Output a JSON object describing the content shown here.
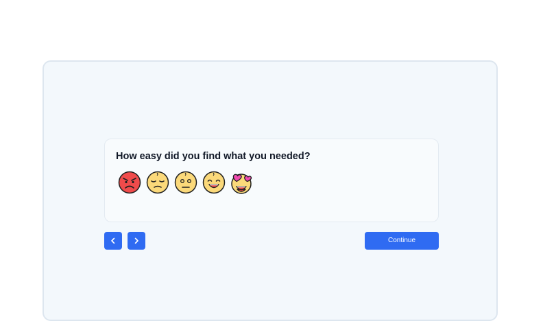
{
  "survey": {
    "question": "How easy did you find what you needed?",
    "ratings": [
      {
        "icon": "angry-face-icon"
      },
      {
        "icon": "sad-face-icon"
      },
      {
        "icon": "neutral-face-icon"
      },
      {
        "icon": "happy-face-icon"
      },
      {
        "icon": "heart-eyes-face-icon"
      }
    ]
  },
  "navigation": {
    "prev_icon": "chevron-left-icon",
    "next_icon": "chevron-right-icon",
    "continue_label": "Continue"
  },
  "colors": {
    "accent": "#2f6bf2",
    "frame_background": "#f3f8fc",
    "card_background": "#f8fbfd",
    "angry_face": "#f04b4b",
    "face_yellow": "#fbd97a",
    "heart_pink": "#f04bb0"
  }
}
